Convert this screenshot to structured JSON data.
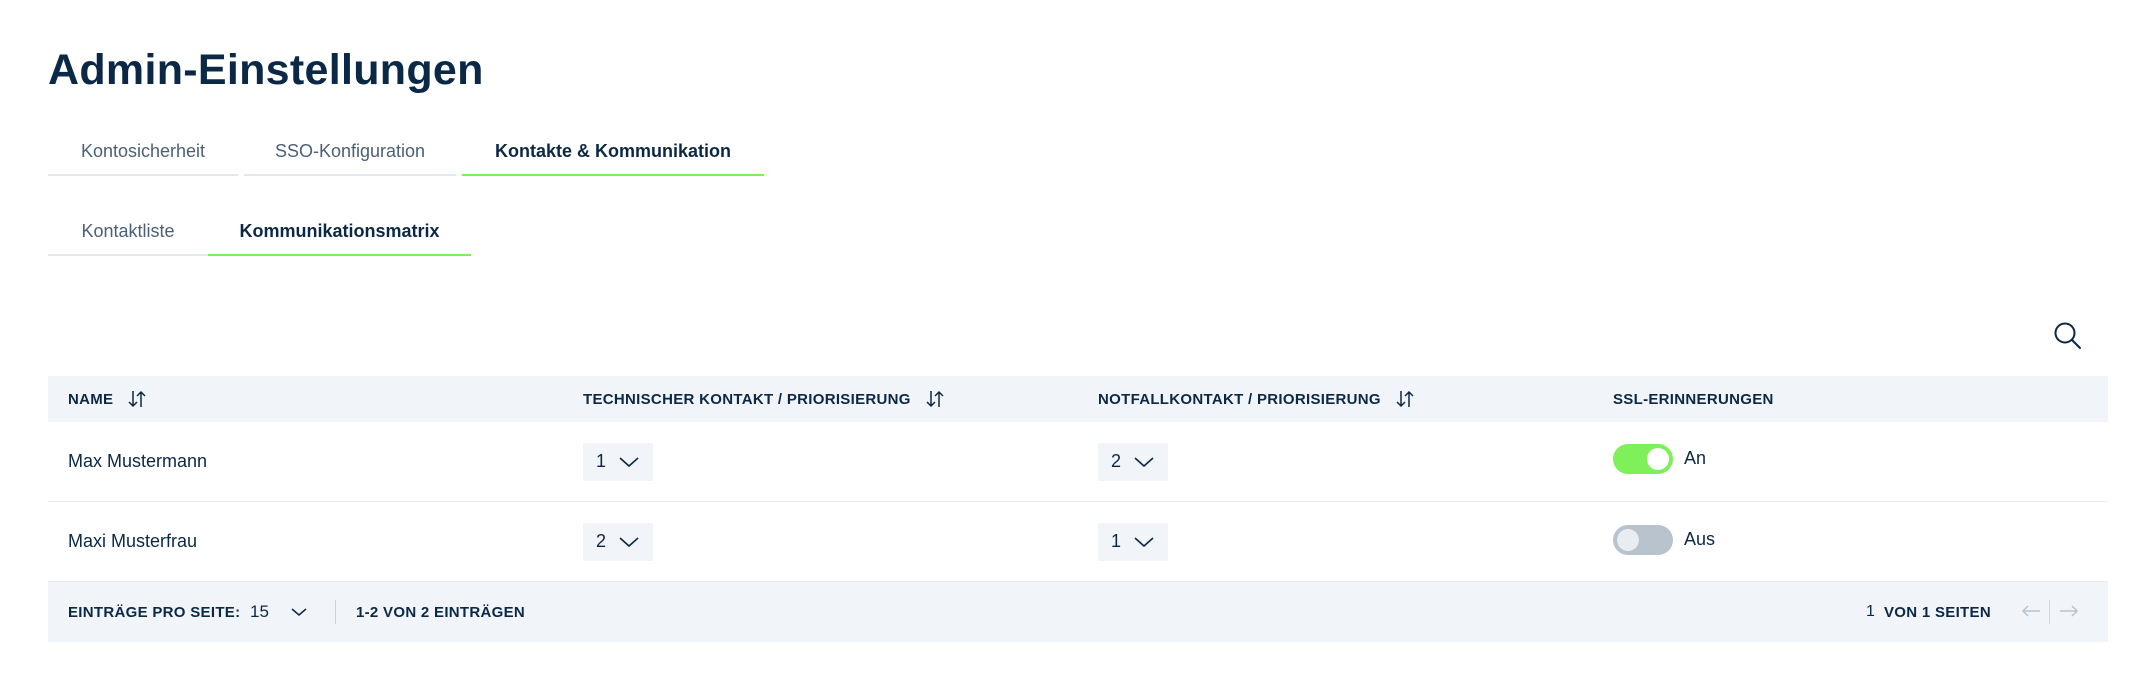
{
  "page": {
    "title": "Admin-Einstellungen"
  },
  "tabs": [
    {
      "label": "Kontosicherheit",
      "active": false
    },
    {
      "label": "SSO-Konfiguration",
      "active": false
    },
    {
      "label": "Kontakte & Kommunikation",
      "active": true
    }
  ],
  "subtabs": [
    {
      "label": "Kontaktliste",
      "active": false
    },
    {
      "label": "Kommunikationsmatrix",
      "active": true
    }
  ],
  "toolbar": {
    "search_icon": "search-icon"
  },
  "table": {
    "columns": [
      {
        "label": "NAME",
        "sortable": true
      },
      {
        "label": "TECHNISCHER KONTAKT / PRIORISIERUNG",
        "sortable": true
      },
      {
        "label": "NOTFALLKONTAKT / PRIORISIERUNG",
        "sortable": true
      },
      {
        "label": "SSL-ERINNERUNGEN",
        "sortable": false
      }
    ],
    "rows": [
      {
        "name": "Max Mustermann",
        "technical_priority": "1",
        "emergency_priority": "2",
        "ssl_reminder_on": true,
        "ssl_label": "An"
      },
      {
        "name": "Maxi Musterfrau",
        "technical_priority": "2",
        "emergency_priority": "1",
        "ssl_reminder_on": false,
        "ssl_label": "Aus"
      }
    ]
  },
  "pagination": {
    "per_page_label": "EINTRÄGE PRO SEITE:",
    "per_page_value": "15",
    "range_text": "1-2 VON 2 EINTRÄGEN",
    "current_page": "1",
    "total_pages_text": "VON 1 SEITEN"
  },
  "colors": {
    "accent": "#7ef05a",
    "text": "#0b2847",
    "header_bg": "#f1f4f8",
    "toggle_off": "#b9c3cd"
  }
}
